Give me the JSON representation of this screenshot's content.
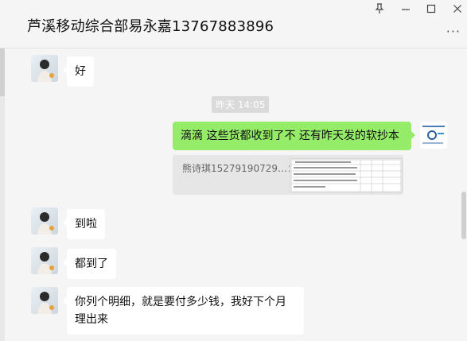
{
  "window": {
    "title": "芦溪移动综合部易永嘉13767883896",
    "pin_icon": "pin-icon",
    "minimize_icon": "minimize-icon",
    "maximize_icon": "maximize-icon",
    "close_icon": "close-icon",
    "more_icon": "more-icon"
  },
  "messages": [
    {
      "side": "left",
      "text": "好"
    },
    {
      "type": "time",
      "text": "昨天 14:05"
    },
    {
      "side": "right",
      "text": "滴滴 这些货都收到了不  还有昨天发的软抄本"
    },
    {
      "type": "quote",
      "text": "熊诗琪15279190729…："
    },
    {
      "side": "left",
      "text": "到啦"
    },
    {
      "side": "left",
      "text": "都到了"
    },
    {
      "side": "left",
      "text": "你列个明细，就是要付多少钱，我好下个月理出来"
    }
  ]
}
